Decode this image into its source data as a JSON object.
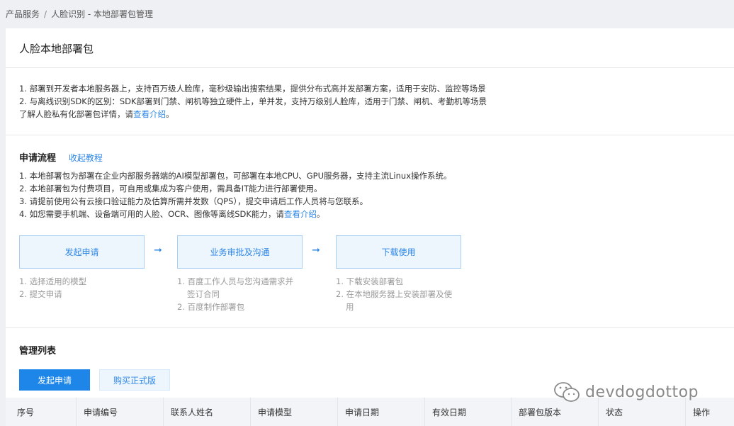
{
  "breadcrumb": {
    "root": "产品服务",
    "separator": "/",
    "current": "人脸识别 - 本地部署包管理"
  },
  "page": {
    "title": "人脸本地部署包"
  },
  "intro": {
    "line1": "1. 部署到开发者本地服务器上，支持百万级人脸库，毫秒级输出搜索结果，提供分布式高并发部署方案，适用于安防、监控等场景",
    "line2": "2. 与离线识别SDK的区别：SDK部署到门禁、闸机等独立硬件上，单并发，支持万级别人脸库，适用于门禁、闸机、考勤机等场景",
    "line3_prefix": "了解人脸私有化部署包详情，请",
    "line3_link": "查看介绍",
    "line3_suffix": "。"
  },
  "flow": {
    "title": "申请流程",
    "toggle_label": "收起教程",
    "items": [
      "1. 本地部署包为部署在企业内部服务器端的AI模型部署包，可部署在本地CPU、GPU服务器，支持主流Linux操作系统。",
      "2. 本地部署包为付费项目，可自用或集成为客户使用，需具备IT能力进行部署使用。",
      "3. 请提前使用公有云接口验证能力及估算所需并发数（QPS），提交申请后工作人员将与您联系。"
    ],
    "item4_prefix": "4. 如您需要手机端、设备端可用的人脸、OCR、图像等离线SDK能力，请",
    "item4_link": "查看介绍",
    "item4_suffix": "。",
    "arrow": "➞",
    "steps": [
      {
        "label": "发起申请",
        "notes": [
          "1. 选择适用的模型",
          "2. 提交申请"
        ]
      },
      {
        "label": "业务审批及沟通",
        "notes": [
          "1. 百度工作人员与您沟通需求并",
          "签订合同",
          "2. 百度制作部署包"
        ]
      },
      {
        "label": "下载使用",
        "notes": [
          "1. 下载安装部署包",
          "2. 在本地服务器上安装部署及使",
          "用"
        ]
      }
    ]
  },
  "management": {
    "title": "管理列表",
    "apply_button": "发起申请",
    "buy_button": "购买正式版",
    "columns": [
      "序号",
      "申请编号",
      "联系人姓名",
      "申请模型",
      "申请日期",
      "有效日期",
      "部署包版本",
      "状态",
      "操作"
    ]
  },
  "watermark": {
    "text": "devdogdottop"
  },
  "colors": {
    "accent": "#1e86e8",
    "link": "#2d86e6",
    "step_bg": "#eef6fd",
    "page_bg": "#eef0f3"
  }
}
